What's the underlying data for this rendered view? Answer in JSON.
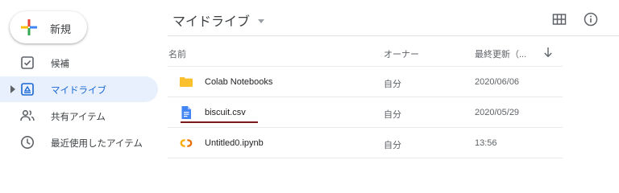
{
  "new_button": {
    "label": "新規"
  },
  "sidebar": {
    "items": [
      {
        "label": "候補",
        "icon": "check-square-icon",
        "active": false
      },
      {
        "label": "マイドライブ",
        "icon": "drive-icon",
        "active": true
      },
      {
        "label": "共有アイテム",
        "icon": "shared-people-icon",
        "active": false
      },
      {
        "label": "最近使用したアイテム",
        "icon": "clock-icon",
        "active": false
      }
    ]
  },
  "header": {
    "title": "マイドライブ"
  },
  "table": {
    "columns": {
      "name": "名前",
      "owner": "オーナー",
      "modified": "最終更新（..."
    },
    "rows": [
      {
        "name": "Colab Notebooks",
        "owner": "自分",
        "modified": "2020/06/06",
        "icon": "folder-icon"
      },
      {
        "name": "biscuit.csv",
        "owner": "自分",
        "modified": "2020/05/29",
        "icon": "document-icon"
      },
      {
        "name": "Untitled0.ipynb",
        "owner": "自分",
        "modified": "13:56",
        "icon": "colab-icon"
      }
    ]
  },
  "colors": {
    "accent": "#1967d2",
    "active_bg": "#e8f0fe",
    "folder": "#fbc02d",
    "doc": "#4285f4",
    "colab": "#f9ab00",
    "underline": "#7a1a1a"
  }
}
